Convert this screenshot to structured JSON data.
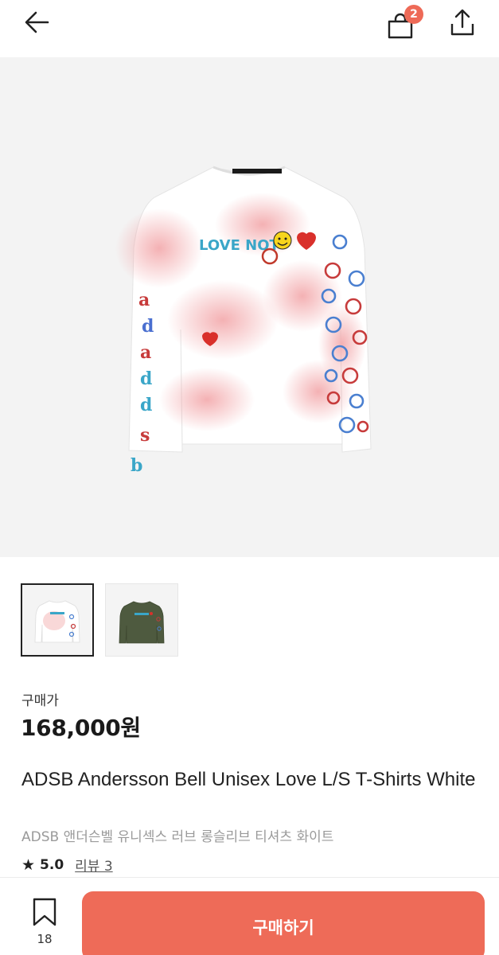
{
  "header": {
    "back_icon": "arrow-left-icon",
    "bag_icon": "shopping-bag-icon",
    "bag_badge_count": "2",
    "share_icon": "share-icon",
    "accent_color": "#ee6a57"
  },
  "gallery": {
    "main_image": "white long sleeve t-shirt with LOVE NOT graphic and peace sign prints",
    "hero_text": "LOVE NOT",
    "thumbnails": [
      {
        "name": "white t-shirt",
        "selected": true
      },
      {
        "name": "khaki t-shirt",
        "selected": false
      }
    ]
  },
  "product": {
    "price_label": "구매가",
    "price": "168,000원",
    "title_en": "ADSB Andersson Bell Unisex Love L/S T-Shirts White",
    "title_ko": "ADSB 앤더슨벨 유니섹스 러브 롱슬리브 티셔츠 화이트",
    "rating_icon": "star-icon",
    "rating": "5.0",
    "review_link": "리뷰 3"
  },
  "footer": {
    "wish_icon": "bookmark-icon",
    "wish_count": "18",
    "buy_label": "구매하기",
    "buy_color": "#ee6b58"
  }
}
